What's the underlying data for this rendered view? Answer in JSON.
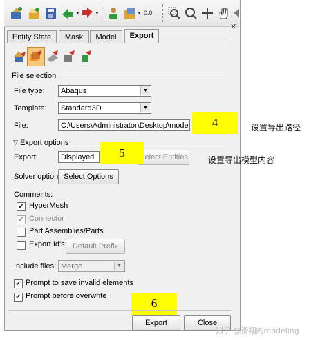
{
  "toolbar": {
    "scale_label": "0.0"
  },
  "tabs": [
    {
      "label": "Entity State"
    },
    {
      "label": "Mask"
    },
    {
      "label": "Model"
    },
    {
      "label": "Export"
    }
  ],
  "file_selection": {
    "title": "File selection",
    "file_type_label": "File type:",
    "file_type_value": "Abaqus",
    "template_label": "Template:",
    "template_value": "Standard3D",
    "file_label": "File:",
    "file_value": "C:\\Users\\Administrator\\Desktop\\model.inp"
  },
  "export_options": {
    "title": "Export options",
    "export_label": "Export:",
    "export_value": "Displayed",
    "select_entities_label": "Select Entities",
    "solver_options_label": "Solver options:",
    "select_options_button": "Select Options",
    "comments_label": "Comments:",
    "comments": [
      {
        "label": "HyperMesh",
        "checked": true,
        "enabled": true
      },
      {
        "label": "Connector",
        "checked": true,
        "enabled": false
      },
      {
        "label": "Part Assemblies/Parts",
        "checked": false,
        "enabled": true
      },
      {
        "label": "Export Id's:",
        "checked": false,
        "enabled": true
      }
    ],
    "default_prefix_button": "Default Prefix",
    "include_files_label": "Include files:",
    "include_files_value": "Merge",
    "prompt_invalid_label": "Prompt to save invalid elements",
    "prompt_overwrite_label": "Prompt before overwrite"
  },
  "buttons": {
    "export": "Export",
    "close": "Close"
  },
  "annotations": {
    "n4": "4",
    "n5": "5",
    "n6": "6",
    "note4": "设置导出路径",
    "note5": "设置导出模型内容"
  },
  "watermark": "知乎 @滑翔的modeling",
  "colors": {
    "highlight": "#ffff00",
    "panel": "#f0f0f0"
  }
}
